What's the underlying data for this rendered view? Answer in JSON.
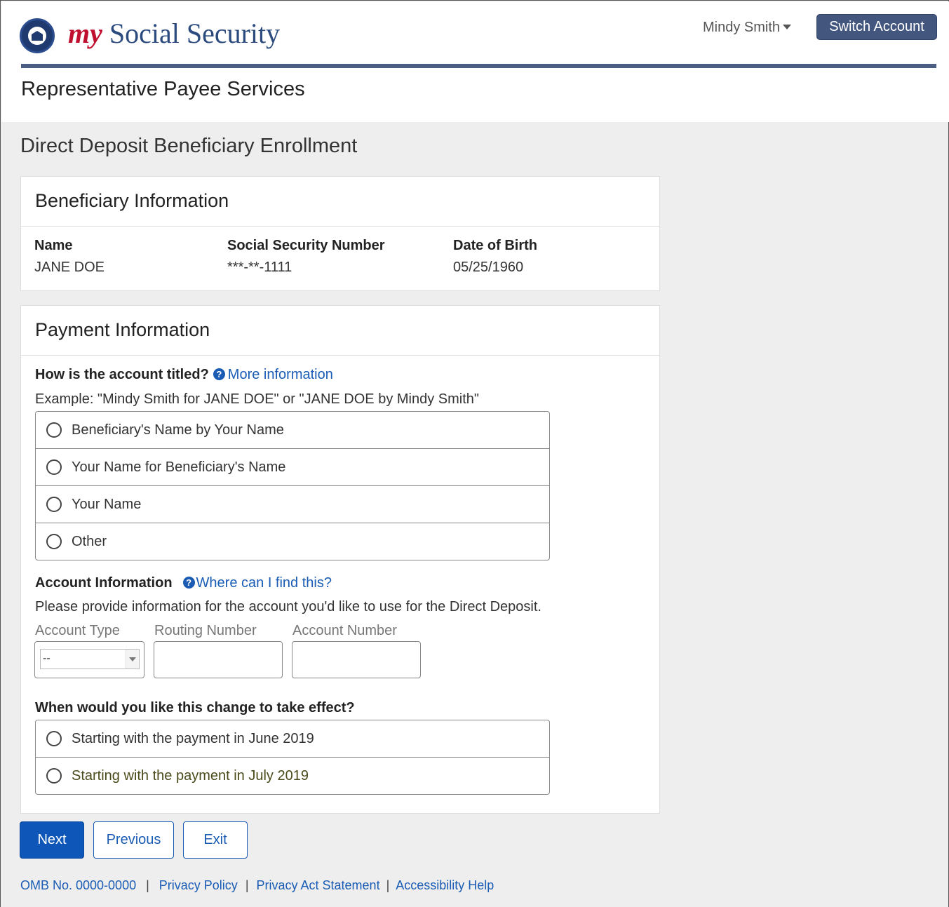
{
  "header": {
    "logo_my": "my",
    "logo_text": "Social Security",
    "user_name": "Mindy Smith",
    "switch_account": "Switch Account",
    "service_title": "Representative Payee Services"
  },
  "page": {
    "title": "Direct Deposit Beneficiary Enrollment"
  },
  "beneficiary": {
    "heading": "Beneficiary Information",
    "name_label": "Name",
    "name_value": "JANE DOE",
    "ssn_label": "Social Security Number",
    "ssn_value": "***-**-1111",
    "dob_label": "Date of Birth",
    "dob_value": "05/25/1960"
  },
  "payment": {
    "heading": "Payment Information",
    "titled_question": "How is the account titled?",
    "titled_help": "More information",
    "titled_example": "Example: \"Mindy Smith for JANE DOE\" or \"JANE DOE by Mindy Smith\"",
    "titled_options": [
      "Beneficiary's Name by Your Name",
      "Your Name for Beneficiary's Name",
      "Your Name",
      "Other"
    ],
    "account_heading": "Account Information",
    "account_help": "Where can I find this?",
    "account_instructions": "Please provide information for the account you'd like to use for the Direct Deposit.",
    "account_type_label": "Account Type",
    "account_type_value": "--",
    "routing_label": "Routing Number",
    "routing_value": "",
    "account_number_label": "Account Number",
    "account_number_value": "",
    "effective_question": "When would you like this change to take effect?",
    "effective_options": [
      "Starting with the payment in June 2019",
      "Starting with the payment in July 2019"
    ]
  },
  "actions": {
    "next": "Next",
    "previous": "Previous",
    "exit": "Exit"
  },
  "footer": {
    "links": [
      "OMB No. 0000-0000",
      "Privacy Policy",
      "Privacy Act Statement",
      "Accessibility Help"
    ],
    "separator": "|"
  },
  "colors": {
    "brand_blue": "#43567e",
    "link_blue": "#1a5cb4",
    "primary_button": "#0e57b8",
    "logo_red": "#c0102f"
  }
}
